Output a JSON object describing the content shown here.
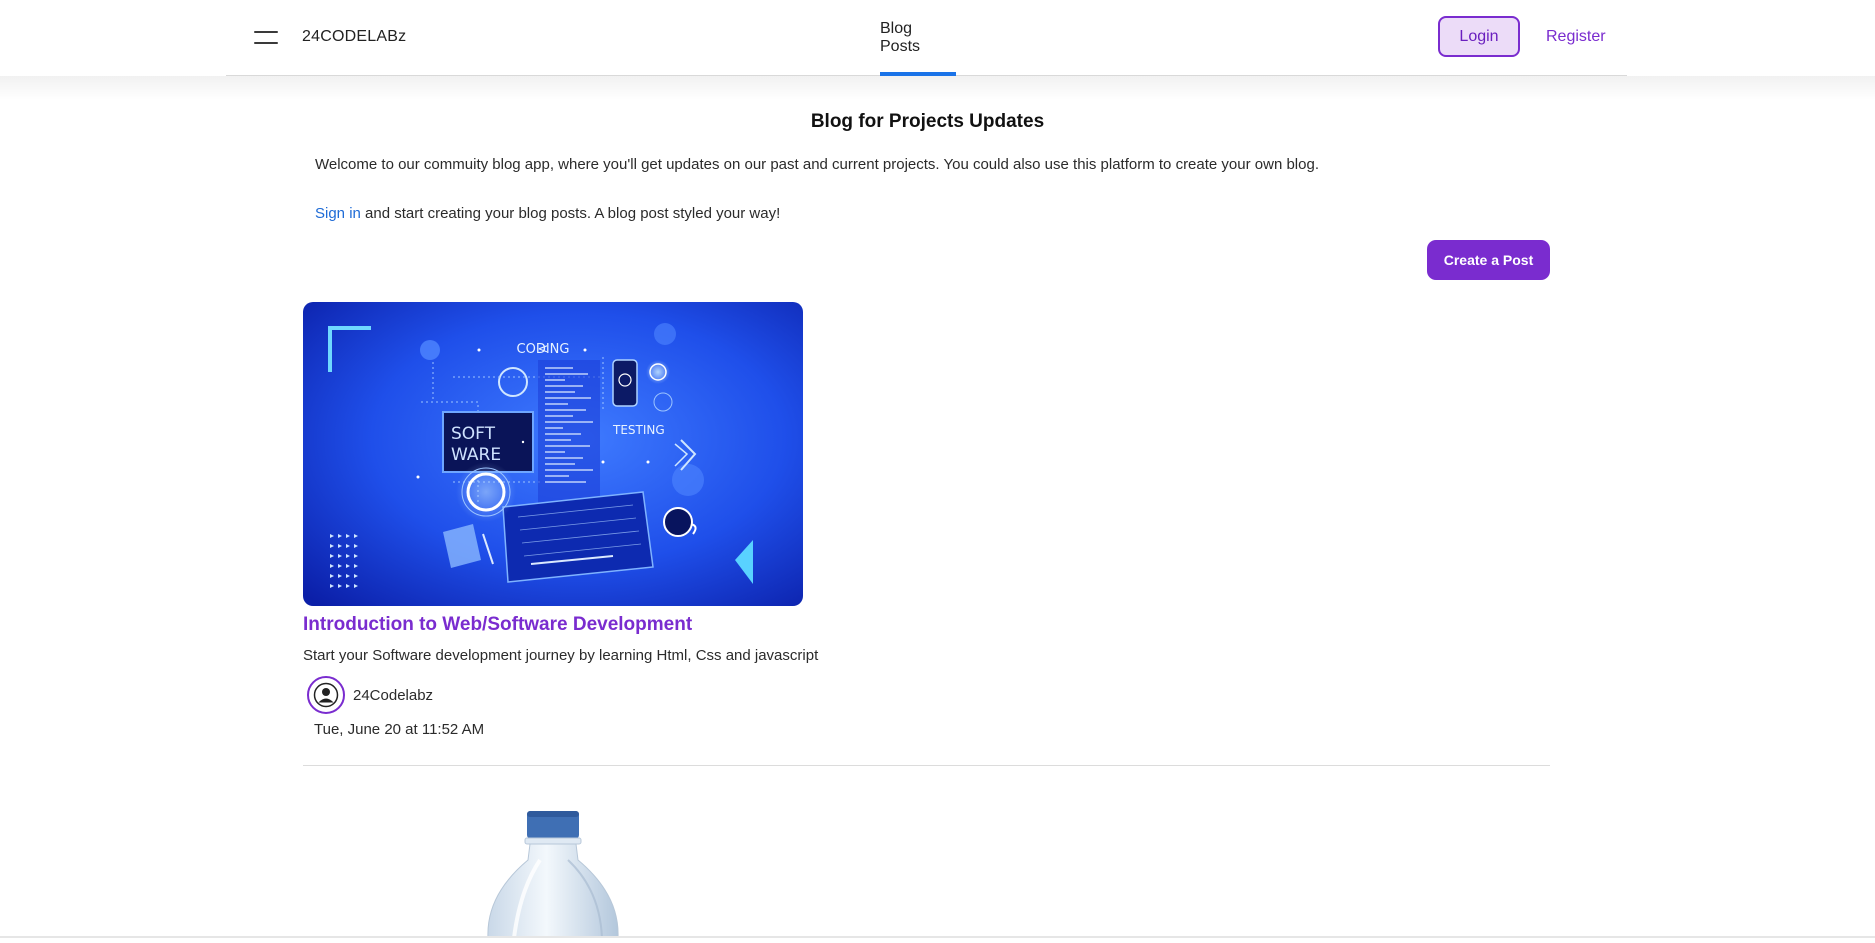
{
  "header": {
    "brand": "24CODELABz",
    "nav_tab": "Blog Posts",
    "login_label": "Login",
    "register_label": "Register",
    "menu_icon": "hamburger-menu-icon",
    "active_color": "#1a73e8",
    "brand_color": "#7a2ccf"
  },
  "main": {
    "title": "Blog for Projects Updates",
    "intro": "Welcome to our commuity blog app, where you'll get updates on our past and current projects. You could also use this platform to create your own blog.",
    "signin_link": "Sign in",
    "signin_rest": " and start creating your blog posts. A blog post styled your way!",
    "create_post_label": "Create a Post"
  },
  "posts": [
    {
      "title": "Introduction to Web/Software Development",
      "description": "Start your Software development journey by learning Html, Css and javascript",
      "author": "24Codelabz",
      "date": "Tue, June 20 at 11:52 AM",
      "image_text": {
        "coding": "CODING",
        "soft": "SOFT",
        "ware": "WARE",
        "testing": "TESTING"
      }
    }
  ]
}
